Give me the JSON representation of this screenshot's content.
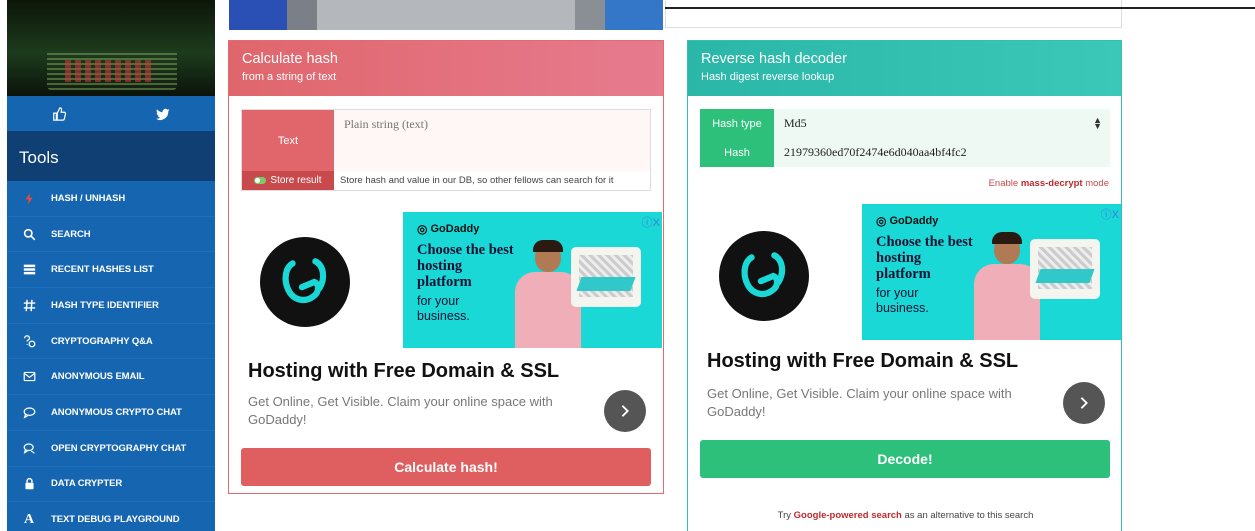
{
  "sidebar": {
    "social": [
      {
        "name": "like-icon"
      },
      {
        "name": "twitter-icon"
      }
    ],
    "tools_title": "Tools",
    "menu": [
      {
        "label": "HASH / UNHASH",
        "icon": "bolt-icon"
      },
      {
        "label": "SEARCH",
        "icon": "search-icon"
      },
      {
        "label": "RECENT HASHES LIST",
        "icon": "list-icon"
      },
      {
        "label": "HASH TYPE IDENTIFIER",
        "icon": "hash-icon"
      },
      {
        "label": "CRYPTOGRAPHY Q&A",
        "icon": "qa-icon"
      },
      {
        "label": "ANONYMOUS EMAIL",
        "icon": "email-icon"
      },
      {
        "label": "ANONYMOUS CRYPTO CHAT",
        "icon": "chat-icon"
      },
      {
        "label": "OPEN CRYPTOGRAPHY CHAT",
        "icon": "chat-group-icon"
      },
      {
        "label": "DATA CRYPTER",
        "icon": "lock-icon"
      },
      {
        "label": "TEXT DEBUG PLAYGROUND",
        "icon": "font-icon"
      }
    ]
  },
  "calc": {
    "title": "Calculate hash",
    "subtitle": "from a string of text",
    "text_label": "Text",
    "text_placeholder": "Plain string (text)",
    "store_label": "Store result",
    "store_desc": "Store hash and value in our DB, so other fellows can search for it",
    "button": "Calculate hash!"
  },
  "reverse": {
    "title": "Reverse hash decoder",
    "subtitle": "Hash digest reverse lookup",
    "type_label": "Hash type",
    "type_value": "Md5",
    "hash_label": "Hash",
    "hash_value": "21979360ed70f2474e6d040aa4bf4fc2",
    "mass_prefix": "Enable ",
    "mass_link": "mass-decrypt",
    "mass_suffix": " mode",
    "button": "Decode!",
    "foot_prefix": "Try ",
    "foot_link": "Google-powered search",
    "foot_suffix": " as an alternative to this search"
  },
  "ad": {
    "brand": "GoDaddy",
    "headline": "Choose the best hosting platform",
    "sub": "for your business.",
    "title": "Hosting with Free Domain & SSL",
    "desc": "Get Online, Get Visible. Claim your online space with GoDaddy!",
    "choice": "ⓘX"
  },
  "colors": {
    "sidebar": "#1565b0",
    "calc_accent": "#e0666c",
    "reverse_accent": "#2bb7a8",
    "decode": "#2cc07a"
  }
}
